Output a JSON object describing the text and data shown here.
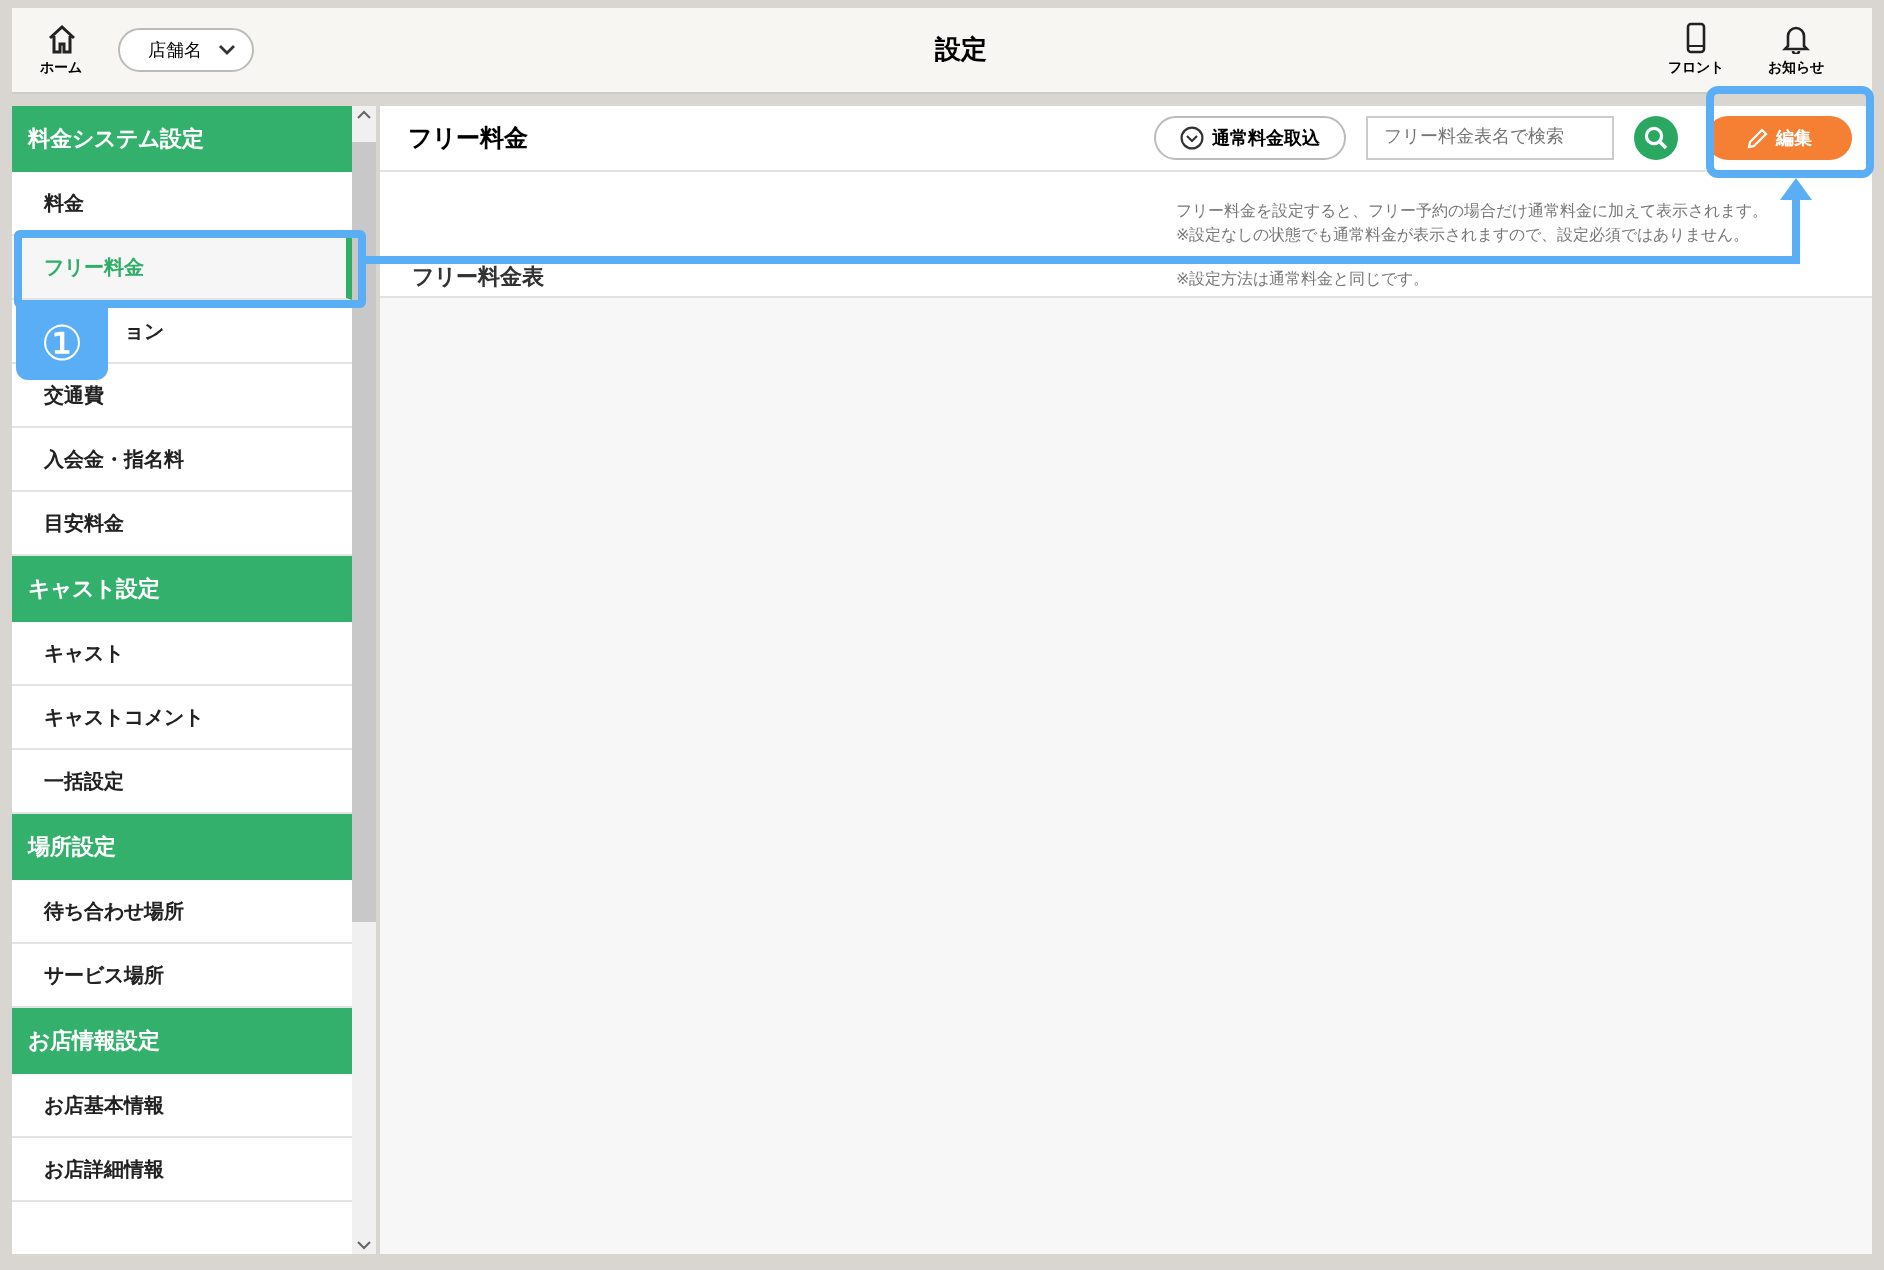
{
  "header": {
    "home_label": "ホーム",
    "store_select": "店舗名",
    "title": "設定",
    "front_label": "フロント",
    "notice_label": "お知らせ"
  },
  "sidebar": {
    "groups": [
      {
        "title": "料金システム設定",
        "items": [
          {
            "label": "料金",
            "selected": false
          },
          {
            "label": "フリー料金",
            "selected": true
          },
          {
            "label": "ョン",
            "selected": false
          },
          {
            "label": "交通費",
            "selected": false
          },
          {
            "label": "入会金・指名料",
            "selected": false
          },
          {
            "label": "目安料金",
            "selected": false
          }
        ]
      },
      {
        "title": "キャスト設定",
        "items": [
          {
            "label": "キャスト",
            "selected": false
          },
          {
            "label": "キャストコメント",
            "selected": false
          },
          {
            "label": "一括設定",
            "selected": false
          }
        ]
      },
      {
        "title": "場所設定",
        "items": [
          {
            "label": "待ち合わせ場所",
            "selected": false
          },
          {
            "label": "サービス場所",
            "selected": false
          }
        ]
      },
      {
        "title": "お店情報設定",
        "items": [
          {
            "label": "お店基本情報",
            "selected": false
          },
          {
            "label": "お店詳細情報",
            "selected": false
          }
        ]
      }
    ]
  },
  "content": {
    "title": "フリー料金",
    "import_button": "通常料金取込",
    "search": {
      "placeholder": "フリー料金表名で検索"
    },
    "edit_button": "編集",
    "notes": [
      "フリー料金を設定すると、フリー予約の場合だけ通常料金に加えて表示されます。",
      "※設定なしの状態でも通常料金が表示されますので、設定必須ではありません。",
      "※設定方法は通常料金と同じです。"
    ],
    "table_title": "フリー料金表"
  },
  "annotation": {
    "step": "①"
  }
}
